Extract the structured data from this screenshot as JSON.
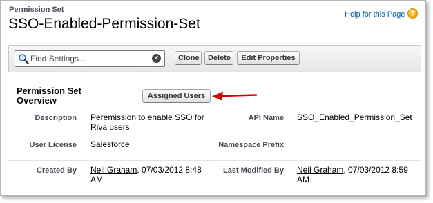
{
  "header": {
    "object_type": "Permission Set",
    "title": "SSO-Enabled-Permission-Set",
    "help_link": "Help for this Page",
    "help_icon": "help-icon"
  },
  "toolbar": {
    "search_placeholder": "Find Settings...",
    "clone_label": "Clone",
    "delete_label": "Delete",
    "edit_properties_label": "Edit Properties"
  },
  "overview": {
    "section_title": "Permission Set Overview",
    "assigned_users_label": "Assigned Users",
    "annotation_color": "#d40000"
  },
  "details": {
    "description_label": "Description",
    "description_value": "Peremission to enable SSO for Riva users",
    "api_name_label": "API Name",
    "api_name_value": "SSO_Enabled_Permission_Set",
    "user_license_label": "User License",
    "user_license_value": "Salesforce",
    "namespace_prefix_label": "Namespace Prefix",
    "namespace_prefix_value": "",
    "created_by_label": "Created By",
    "created_by_user": "Neil Graham",
    "created_by_date": ", 07/03/2012 8:48 AM",
    "last_modified_label": "Last Modified By",
    "last_modified_user": "Neil Graham",
    "last_modified_date": ", 07/03/2012 8:59 AM"
  }
}
